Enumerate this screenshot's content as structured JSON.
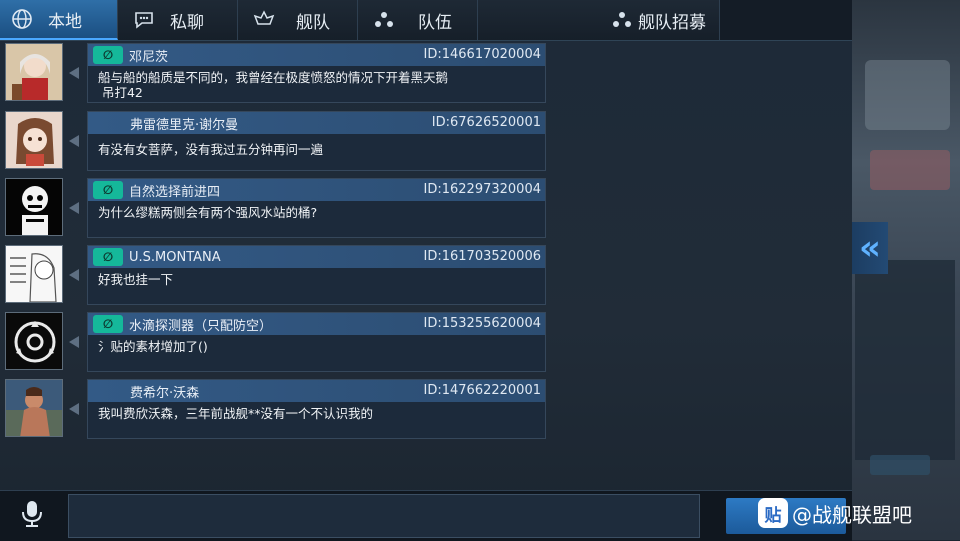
{
  "tabs": [
    {
      "label": "本地",
      "icon": "globe-icon",
      "active": true
    },
    {
      "label": "私聊",
      "icon": "chat-bubble-icon",
      "active": false
    },
    {
      "label": "舰队",
      "icon": "fleet-emblem-icon",
      "active": false
    },
    {
      "label": "队伍",
      "icon": "team-dots-icon",
      "active": false
    },
    {
      "label": "舰队招募",
      "icon": "team-dots-icon",
      "active": false
    }
  ],
  "messages": [
    {
      "avatar": "avatar-anime-girl-red",
      "badge": "∅",
      "name": "邓尼茨",
      "id": "ID:146617020004",
      "text": "船与船的船质是不同的，我曾经在极度愤怒的情况下开着黑天鹅\n 吊打42"
    },
    {
      "avatar": "avatar-anime-girl-brown-hair",
      "badge": "",
      "name": "弗雷德里克·谢尔曼",
      "id": "ID:67626520001",
      "text": "有没有女菩萨，没有我过五分钟再问一遍"
    },
    {
      "avatar": "avatar-skeleton",
      "badge": "∅",
      "name": "自然选择前进四",
      "id": "ID:162297320004",
      "text": "为什么缪糕两侧会有两个强风水站的桶?"
    },
    {
      "avatar": "avatar-sketch-girl",
      "badge": "∅",
      "name": "U.S.MONTANA",
      "id": "ID:161703520006",
      "text": "好我也挂一下"
    },
    {
      "avatar": "avatar-scp-logo",
      "badge": "∅",
      "name": "水滴探测器（只配防空）",
      "id": "ID:153255620004",
      "text": "氵贴的素材增加了()"
    },
    {
      "avatar": "avatar-warrior",
      "badge": "",
      "name": "费希尔·沃森",
      "id": "ID:147662220001",
      "text": "我叫费欣沃森，三年前战舰**没有一个不认识我的"
    }
  ],
  "input": {
    "value": ""
  },
  "watermark": {
    "text": "@战舰联盟吧",
    "logo": "贴"
  },
  "colors": {
    "accent": "#2f6fa8",
    "badge": "#15b89a",
    "chevron": "#5fb2ff"
  }
}
